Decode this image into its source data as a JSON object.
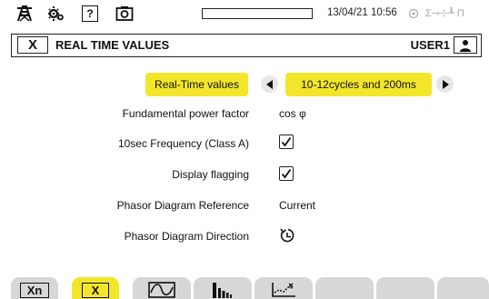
{
  "status_bar": {
    "icons": [
      "tower-icon",
      "settings-icon",
      "help-icon",
      "camera-icon"
    ],
    "help_glyph": "?",
    "datetime": "13/04/21 10:56",
    "recording_progress": 0.0,
    "extra": "Σ⊸⊹┸ Π"
  },
  "title_bar": {
    "close_label": "X",
    "title": "REAL TIME VALUES",
    "user": "USER1"
  },
  "settings": {
    "real_time": {
      "label": "Real-Time values",
      "value": "10-12cycles and 200ms"
    },
    "power_factor": {
      "label": "Fundamental power factor",
      "value": "cos φ"
    },
    "frequency": {
      "label": "10sec Frequency (Class A)",
      "checked": true
    },
    "flagging": {
      "label": "Display flagging",
      "checked": true
    },
    "phasor_reference": {
      "label": "Phasor Diagram Reference",
      "value": "Current"
    },
    "phasor_direction": {
      "label": "Phasor Diagram Direction",
      "icon": "rotate-counterclockwise-icon"
    }
  },
  "tabs": [
    {
      "name": "Xn",
      "active": false
    },
    {
      "name": "X",
      "active": true
    },
    {
      "name": "waveform-icon",
      "active": false
    },
    {
      "name": "harmonics-icon",
      "active": false
    },
    {
      "name": "trend-icon",
      "active": false
    },
    {
      "name": "empty",
      "active": false
    },
    {
      "name": "empty",
      "active": false
    },
    {
      "name": "empty",
      "active": false
    }
  ],
  "colors": {
    "accent": "#f3e62a",
    "tab_inactive": "#d7d7d7",
    "arrow_bg": "#e6e6e6"
  }
}
